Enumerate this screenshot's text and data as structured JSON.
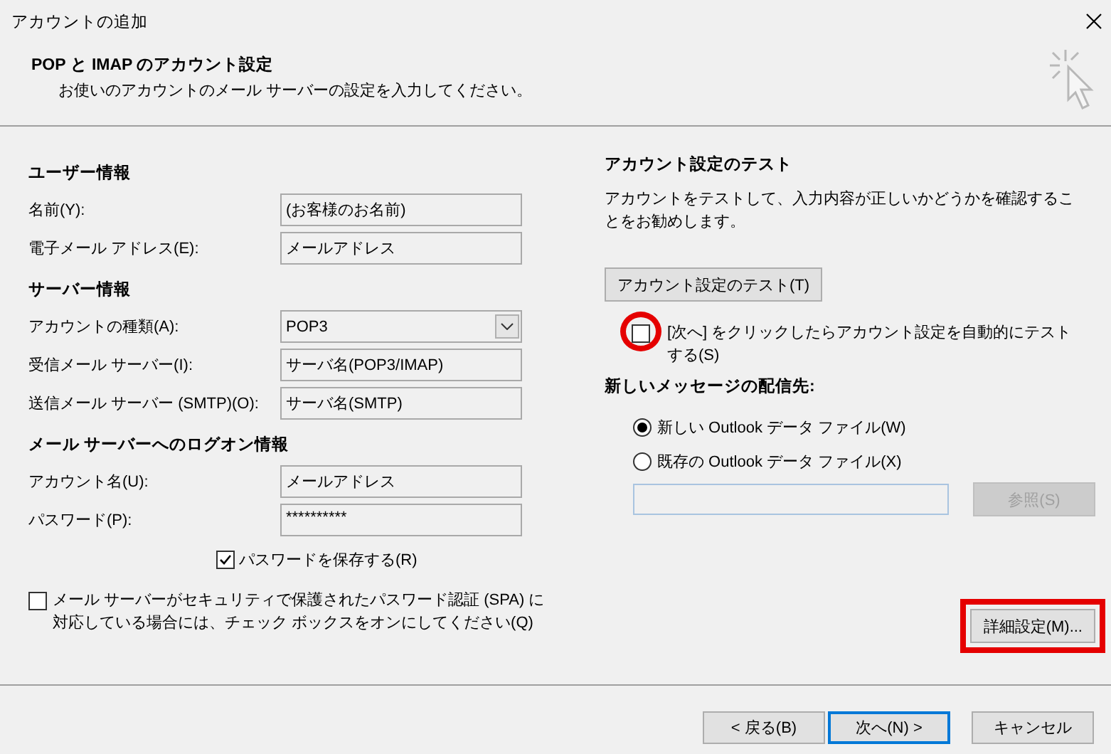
{
  "window": {
    "title": "アカウントの追加"
  },
  "header": {
    "title": "POP と IMAP のアカウント設定",
    "subtitle": "お使いのアカウントのメール サーバーの設定を入力してください。"
  },
  "left": {
    "sections": [
      {
        "heading": "ユーザー情報",
        "fields": [
          {
            "label": "名前(Y):",
            "value": "(お客様のお名前)",
            "kind": "text"
          },
          {
            "label": "電子メール アドレス(E):",
            "value": "メールアドレス",
            "kind": "text"
          }
        ]
      },
      {
        "heading": "サーバー情報",
        "fields": [
          {
            "label": "アカウントの種類(A):",
            "value": "POP3",
            "kind": "dropdown"
          },
          {
            "label": "受信メール サーバー(I):",
            "value": "サーバ名(POP3/IMAP)",
            "kind": "text"
          },
          {
            "label": "送信メール サーバー (SMTP)(O):",
            "value": "サーバ名(SMTP)",
            "kind": "text"
          }
        ]
      },
      {
        "heading": "メール サーバーへのログオン情報",
        "fields": [
          {
            "label": "アカウント名(U):",
            "value": "メールアドレス",
            "kind": "text"
          },
          {
            "label": "パスワード(P):",
            "value": "**********",
            "kind": "password"
          }
        ]
      }
    ],
    "save_password": {
      "label": "パスワードを保存する(R)",
      "checked": true
    },
    "spa": {
      "label": "メール サーバーがセキュリティで保護されたパスワード認証 (SPA) に対応している場合には、チェック ボックスをオンにしてください(Q)",
      "checked": false
    }
  },
  "right": {
    "heading": "アカウント設定のテスト",
    "description": "アカウントをテストして、入力内容が正しいかどうかを確認することをお勧めします。",
    "test_button": "アカウント設定のテスト(T)",
    "auto_test": {
      "label": "[次へ] をクリックしたらアカウント設定を自動的にテストする(S)",
      "checked": false,
      "highlighted": true
    },
    "delivery_heading": "新しいメッセージの配信先:",
    "delivery_options": [
      {
        "label": "新しい Outlook データ ファイル(W)",
        "selected": true
      },
      {
        "label": "既存の Outlook データ ファイル(X)",
        "selected": false
      }
    ],
    "browse_button": {
      "label": "参照(S)",
      "disabled": true
    },
    "more_settings": {
      "label": "詳細設定(M)...",
      "highlighted": true
    }
  },
  "footer": {
    "buttons": [
      {
        "label": "< 戻る(B)",
        "default": false
      },
      {
        "label": "次へ(N) >",
        "default": true
      },
      {
        "label": "キャンセル",
        "default": false
      }
    ]
  }
}
